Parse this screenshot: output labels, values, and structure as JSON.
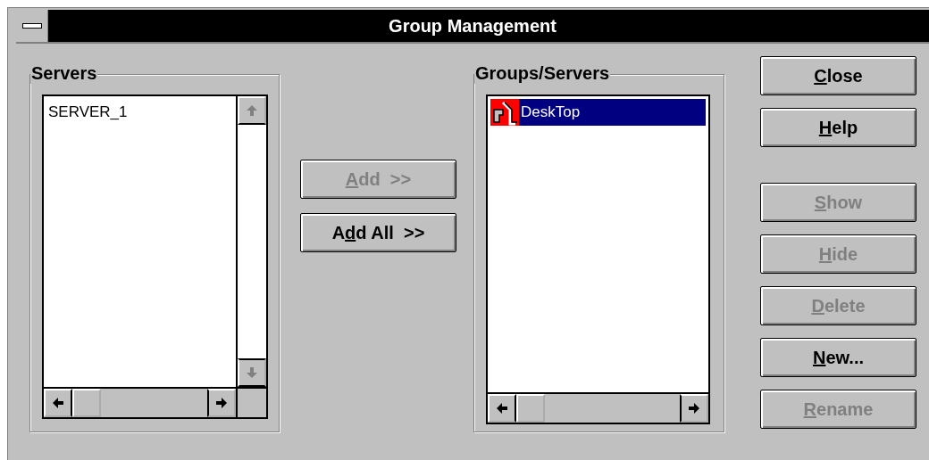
{
  "window": {
    "title": "Group Management"
  },
  "servers": {
    "label": "Servers",
    "items": [
      {
        "text": "SERVER_1",
        "selected": false
      }
    ]
  },
  "move_buttons": [
    {
      "label_parts": [
        {
          "text": "A",
          "underline": true
        },
        {
          "text": "dd  >>",
          "underline": false
        }
      ],
      "disabled": true
    },
    {
      "label_parts": [
        {
          "text": "A",
          "underline": false
        },
        {
          "text": "d",
          "underline": true
        },
        {
          "text": "d All  >>",
          "underline": false
        }
      ],
      "disabled": false
    }
  ],
  "groups": {
    "label": "Groups/Servers",
    "items": [
      {
        "text": "DeskTop",
        "selected": true
      }
    ]
  },
  "buttons": [
    {
      "label_parts": [
        {
          "text": "C",
          "underline": true
        },
        {
          "text": "lose",
          "underline": false
        }
      ],
      "disabled": false
    },
    {
      "label_parts": [
        {
          "text": "H",
          "underline": true
        },
        {
          "text": "elp",
          "underline": false
        }
      ],
      "disabled": false
    },
    {
      "label_parts": [
        {
          "text": "S",
          "underline": true
        },
        {
          "text": "how",
          "underline": false
        }
      ],
      "disabled": true
    },
    {
      "label_parts": [
        {
          "text": "H",
          "underline": true
        },
        {
          "text": "ide",
          "underline": false
        }
      ],
      "disabled": true
    },
    {
      "label_parts": [
        {
          "text": "D",
          "underline": true
        },
        {
          "text": "elete",
          "underline": false
        }
      ],
      "disabled": true
    },
    {
      "label_parts": [
        {
          "text": "N",
          "underline": true
        },
        {
          "text": "ew...",
          "underline": false
        }
      ],
      "disabled": false
    },
    {
      "label_parts": [
        {
          "text": "R",
          "underline": true
        },
        {
          "text": "ename",
          "underline": false
        }
      ],
      "disabled": true
    }
  ]
}
